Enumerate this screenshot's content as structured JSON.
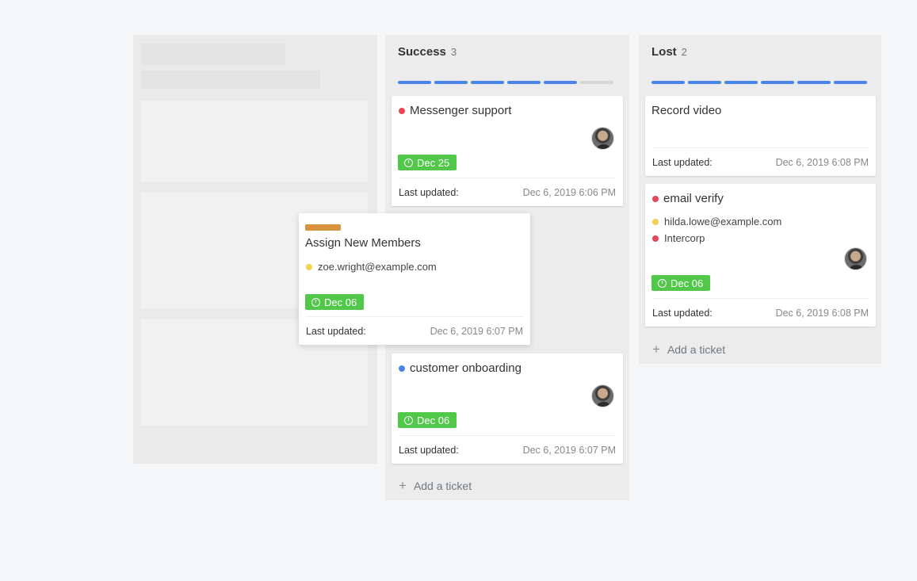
{
  "columns": {
    "success": {
      "title": "Success",
      "count": "3",
      "progress_filled": 5,
      "progress_total": 6,
      "add_ticket_label": "Add a ticket",
      "cards": [
        {
          "title": "Messenger support",
          "dot_color": "#e8445a",
          "due": "Dec 25",
          "updated_label": "Last updated:",
          "updated": "Dec 6, 2019 6:06 PM"
        },
        {
          "title": "customer onboarding",
          "dot_color": "#4a86e8",
          "due": "Dec 06",
          "updated_label": "Last updated:",
          "updated": "Dec 6, 2019 6:07 PM"
        }
      ]
    },
    "lost": {
      "title": "Lost",
      "count": "2",
      "progress_filled": 6,
      "progress_total": 6,
      "add_ticket_label": "Add a ticket",
      "cards": [
        {
          "title": "Record video",
          "updated_label": "Last updated:",
          "updated": "Dec 6, 2019 6:08 PM"
        },
        {
          "title": "email verify",
          "dot_color": "#e8445a",
          "email": "hilda.lowe@example.com",
          "company": "Intercorp",
          "due": "Dec 06",
          "updated_label": "Last updated:",
          "updated": "Dec 6, 2019 6:08 PM"
        }
      ]
    }
  },
  "dragging_card": {
    "label_color": "#d9933e",
    "title": "Assign New Members",
    "email": "zoe.wright@example.com",
    "due": "Dec 06",
    "updated_label": "Last updated:",
    "updated": "Dec 6, 2019 6:07 PM"
  },
  "colors": {
    "accent": "#4a86e8",
    "due_badge": "#52c84b",
    "danger": "#e8445a",
    "warning": "#f5cf4e"
  }
}
